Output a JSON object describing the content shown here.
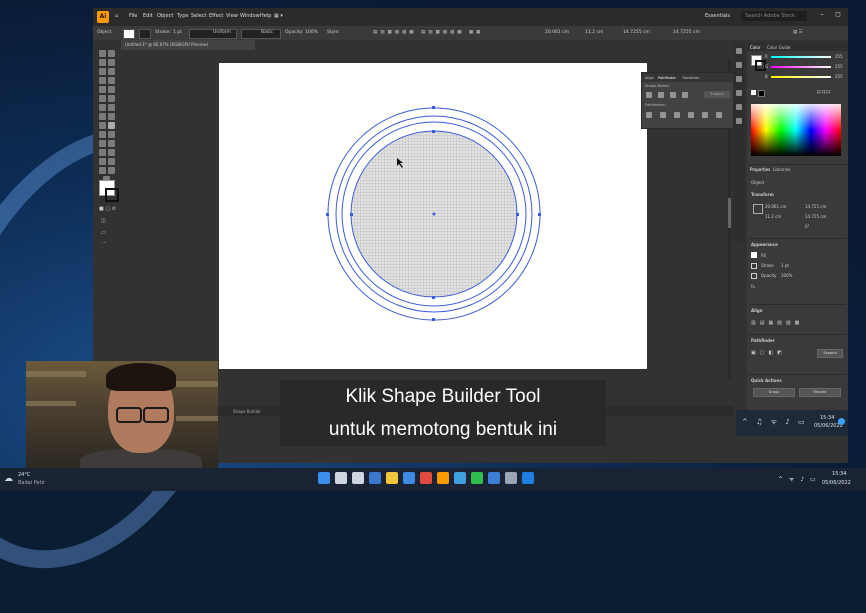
{
  "app": {
    "logo": "Ai",
    "menu": [
      "File",
      "Edit",
      "Object",
      "Type",
      "Select",
      "Effect",
      "View",
      "Window",
      "Help"
    ],
    "workspace": "Essentials",
    "search_placeholder": "Search Adobe Stock",
    "document_tab": "Untitled-1* @ 66.67% (RGB/GPU Preview)"
  },
  "control_bar": {
    "object_label": "Object",
    "stroke_label": "Stroke:",
    "stroke_value": "1 pt",
    "uniform_label": "Uniform",
    "basic_label": "Basic",
    "opacity_label": "Opacity:",
    "opacity_value": "100%",
    "style_label": "Style:",
    "x_value": "20.061 cm",
    "y_value": "11.2 cm",
    "w_value": "14.7255 cm",
    "h_value": "14.7255 cm"
  },
  "status_bar": {
    "zoom": "66.67%",
    "tool": "Shape Builder"
  },
  "pathfinder_panel": {
    "tabs": [
      "Align",
      "Pathfinder",
      "Transform"
    ],
    "shape_modes": "Shape Modes:",
    "expand": "Expand",
    "pathfinders": "Pathfinders:"
  },
  "right_panel": {
    "color_tabs": [
      "Color",
      "Color Guide"
    ],
    "rgb": [
      {
        "channel": "R",
        "value": "255",
        "color": "#e04040"
      },
      {
        "channel": "G",
        "value": "255",
        "color": "#40c040"
      },
      {
        "channel": "B",
        "value": "255",
        "color": "#4060e0"
      }
    ],
    "hex": "FFFFFF",
    "props_tabs": [
      "Properties",
      "Libraries"
    ],
    "object_type": "Object",
    "transform_label": "Transform",
    "transform": {
      "x": "20.061 cm",
      "y": "11.2 cm",
      "w": "14.725 cm",
      "h": "14.725 cm",
      "angle": "0°"
    },
    "appearance_label": "Appearance",
    "fill_label": "Fill",
    "stroke_label": "Stroke",
    "stroke_value": "1 pt",
    "opacity_label": "Opacity",
    "opacity_value": "100%",
    "fx_label": "fx.",
    "align_label": "Align",
    "pathfinder_label": "Pathfinder",
    "expand_label": "Expand",
    "quick_actions_label": "Quick Actions",
    "group_btn": "Group",
    "recolor_btn": "Recolor"
  },
  "subtitles": {
    "line1": "Klik Shape Builder Tool",
    "line2": "untuk memotong bentuk ini"
  },
  "tray_popup": {
    "time": "15:34",
    "date": "05/06/2022"
  },
  "taskbar": {
    "weather_temp": "24°C",
    "weather_desc": "Badai Petir",
    "time": "15:34",
    "date": "05/06/2022",
    "apps": [
      {
        "name": "start-icon",
        "color": "#3b8eea"
      },
      {
        "name": "search-icon",
        "color": "#cfd6e2"
      },
      {
        "name": "task-view-icon",
        "color": "#cfd6e2"
      },
      {
        "name": "widgets-icon",
        "color": "#3a78d0"
      },
      {
        "name": "file-explorer-icon",
        "color": "#f3c53a"
      },
      {
        "name": "store-icon",
        "color": "#3f8be2"
      },
      {
        "name": "chrome-icon",
        "color": "#e24b3b"
      },
      {
        "name": "illustrator-icon",
        "color": "#ff9a00"
      },
      {
        "name": "person-icon",
        "color": "#3fa0e0"
      },
      {
        "name": "whatsapp-icon",
        "color": "#2fbf4f"
      },
      {
        "name": "mail-icon",
        "color": "#3a7fd5"
      },
      {
        "name": "settings-icon",
        "color": "#9aa6b8"
      },
      {
        "name": "photos-icon",
        "color": "#1f7fe0"
      }
    ]
  },
  "colors": {
    "artboard": "#ffffff",
    "path_stroke": "#3b5bdb",
    "grid_fill": "#d9d9d9",
    "grid_line": "#9a9a9a",
    "illustrator_bg": "#323232"
  }
}
